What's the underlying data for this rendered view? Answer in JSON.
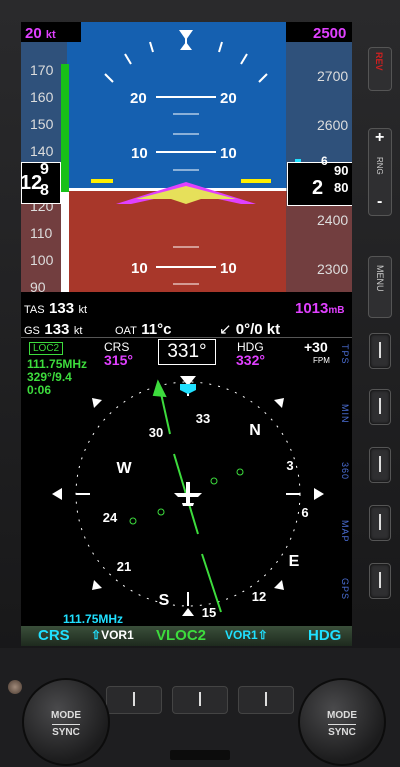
{
  "pfd": {
    "speed_bug": "20",
    "speed_unit": "kt",
    "alt_bug": "2500",
    "speed_ticks": [
      "170",
      "160",
      "150",
      "140",
      "120",
      "110",
      "100",
      "90"
    ],
    "alt_ticks": [
      "2700",
      "2600",
      "2400",
      "2300"
    ],
    "pitch_labels": [
      "20",
      "10",
      "10"
    ],
    "airspeed_readout": "9",
    "airspeed_readout_top": "9",
    "airspeed_readout_bottom": "8",
    "airspeed_readout_lead": "12",
    "alt_readout_lead": "2",
    "alt_readout_top": "90",
    "alt_readout_mid": "80",
    "alt_small_6": "6",
    "tas_label": "TAS",
    "tas_value": "133",
    "tas_unit": "kt",
    "gs_label": "GS",
    "gs_value": "133",
    "gs_unit": "kt",
    "oat_label": "OAT",
    "oat_value": "11°c",
    "wind_value": "0°/0 kt",
    "baro_value": "1013",
    "baro_unit": "mB"
  },
  "hsi": {
    "nav_source_box": "LOC2",
    "freq": "111.75MHz",
    "bearing_dist": "329°/9.4",
    "time": "0:06",
    "crs_label": "CRS",
    "crs_value": "315°",
    "heading_value": "331°",
    "hdg_label": "HDG",
    "hdg_value": "332°",
    "vs_value": "+30",
    "vs_unit": "FPM",
    "compass_labels": [
      "33",
      "N",
      "3",
      "6",
      "E",
      "12",
      "15",
      "S",
      "21",
      "24",
      "W",
      "30"
    ],
    "bottom_freq": "111.75MHz"
  },
  "softkeys": {
    "crs": "CRS",
    "vor1_left": "VOR1",
    "vloc2": "VLOC2",
    "vor1_right": "VOR1",
    "hdg": "HDG"
  },
  "side_labels": {
    "rev": "REV",
    "rng": "RNG",
    "menu": "MENU",
    "tps": "TPS",
    "min": "MIN",
    "three60": "360",
    "map": "MAP",
    "gps": "GPS"
  },
  "knobs": {
    "left_top": "MODE",
    "left_bottom": "SYNC",
    "right_top": "MODE",
    "right_bottom": "SYNC"
  },
  "colors": {
    "sky": "#1560b0",
    "ground": "#a8372a",
    "magenta": "#e040ff",
    "green": "#3ddc3d",
    "cyan": "#20e0ff"
  }
}
